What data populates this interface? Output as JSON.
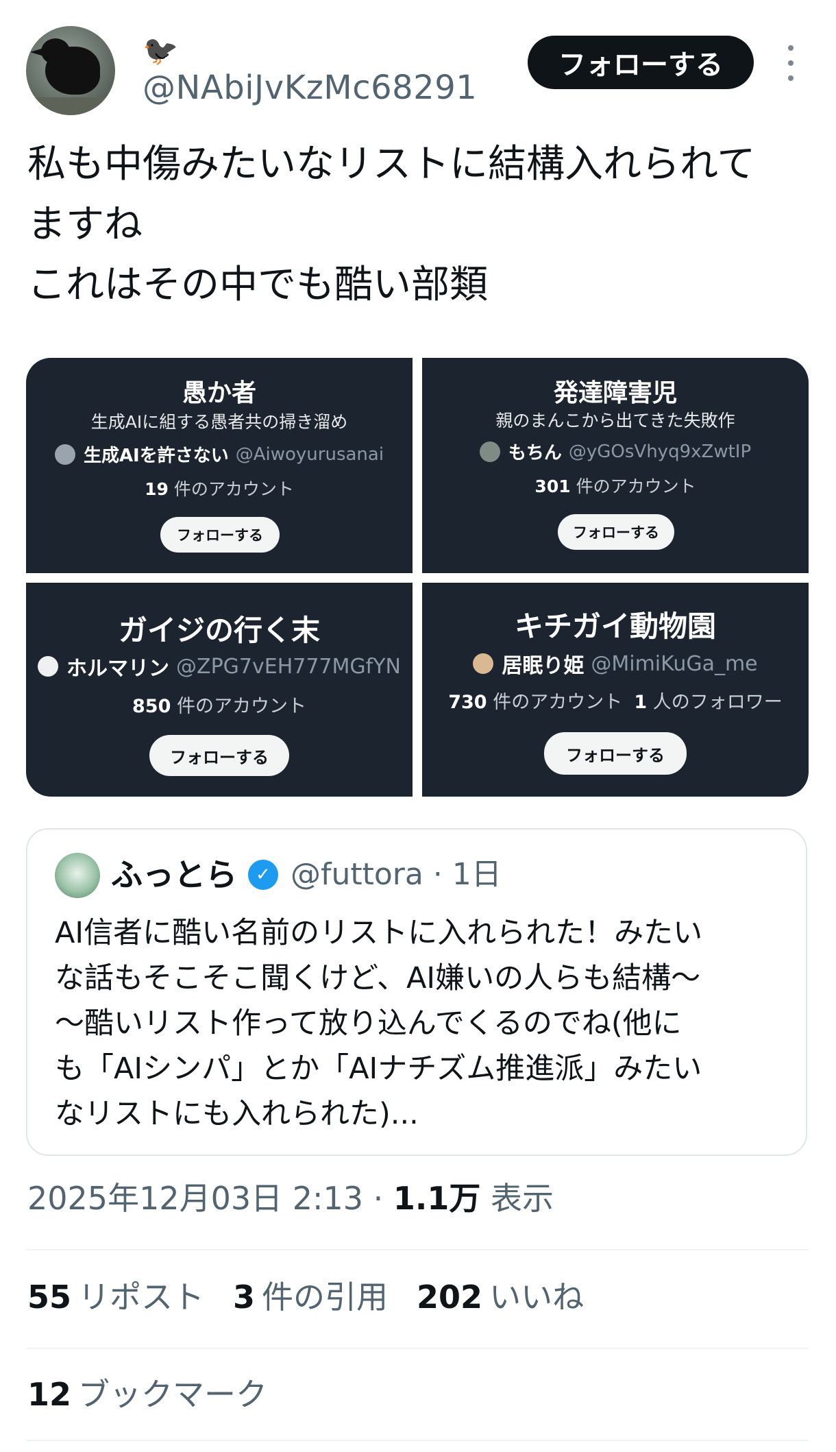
{
  "author": {
    "emoji": "🐦‍⬛",
    "handle": "@NAbiJvKzMc68291",
    "follow_label": "フォローする"
  },
  "tweet": {
    "text": "私も中傷みたいなリストに結構入れられて\nますね\nこれはその中でも酷い部類"
  },
  "lists": [
    {
      "title": "愚か者",
      "description": "生成AIに組する愚者共の掃き溜め",
      "owner_name": "生成AIを許さない",
      "owner_handle": "@Aiwoyurusanai",
      "count": "19",
      "count_label": "件のアカウント",
      "followers": "",
      "followers_label": "",
      "follow_label": "フォローする"
    },
    {
      "title": "発達障害児",
      "description": "親のまんこから出てきた失敗作",
      "owner_name": "もちん",
      "owner_handle": "@yGOsVhyq9xZwtIP",
      "count": "301",
      "count_label": "件のアカウント",
      "followers": "",
      "followers_label": "",
      "follow_label": "フォローする"
    },
    {
      "title": "ガイジの行く末",
      "description": "",
      "owner_name": "ホルマリン",
      "owner_handle": "@ZPG7vEH777MGfYN",
      "count": "850",
      "count_label": "件のアカウント",
      "followers": "",
      "followers_label": "",
      "follow_label": "フォローする"
    },
    {
      "title": "キチガイ動物園",
      "description": "",
      "owner_name": "居眠り姫",
      "owner_handle": "@MimiKuGa_me",
      "count": "730",
      "count_label": "件のアカウント",
      "followers": "1",
      "followers_label": "人のフォロワー",
      "follow_label": "フォローする"
    }
  ],
  "quote": {
    "name": "ふっとら",
    "verified_icon": "✓",
    "handle": "@futtora",
    "time": "· 1日",
    "text": "AI信者に酷い名前のリストに入れられた！みたい\nな話もそこそこ聞くけど、AI嫌いの人らも結構〜\n〜酷いリスト作って放り込んでくるのでね(他に\nも「AIシンパ」とか「AIナチズム推進派」みたい\nなリストにも入れられた)..."
  },
  "meta": {
    "date": "2025年12月03日 2:13 ·",
    "views": "1.1万",
    "views_label": "表示"
  },
  "stats": {
    "reposts": "55",
    "reposts_label": "リポスト",
    "quotes": "3",
    "quotes_label": "件の引用",
    "likes": "202",
    "likes_label": "いいね",
    "bookmarks": "12",
    "bookmarks_label": "ブックマーク"
  },
  "icons": {
    "more": "more-vertical-icon",
    "verified": "verified-badge-icon"
  },
  "colors": {
    "card_bg": "#1c2430",
    "follow_bg": "#0f1419",
    "verified": "#1d9bf0",
    "muted": "#536471"
  }
}
